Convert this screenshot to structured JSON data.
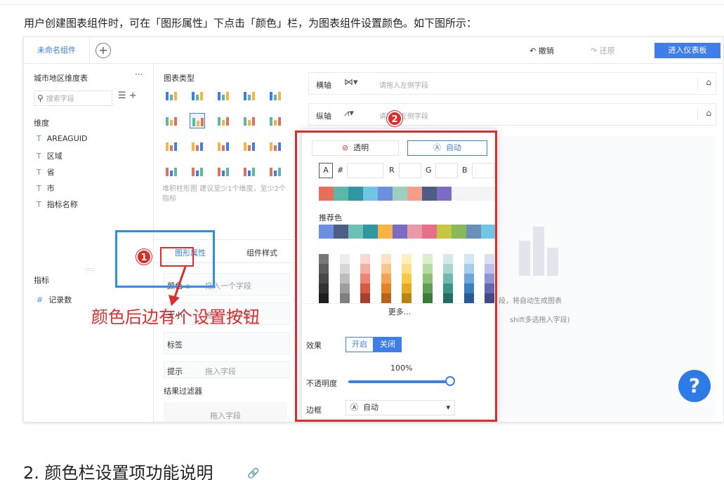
{
  "intro_text": "用户创建图表组件时，可在「图形属性」下点击「颜色」栏，为图表组件设置颜色。如下图所示：",
  "topbar": {
    "tab_label": "未命名组件",
    "add_symbol": "+",
    "undo_label": "撤销",
    "redo_label": "还原",
    "enter_label": "进入仪表板"
  },
  "datapanel": {
    "title": "城市地区维度表",
    "more": "···",
    "search_placeholder": "搜索字段",
    "dimension_title": "维度",
    "dimensions": [
      "AREAGUID",
      "区域",
      "省",
      "市",
      "指标名称"
    ],
    "dimension_type_icon": "T",
    "metric_title": "指标",
    "metrics": [
      "记录数"
    ],
    "metric_type_icon": "#"
  },
  "typepanel": {
    "title": "图表类型",
    "description": "堆积柱形图 建议至少1个维度，至少2个指标",
    "tab_graphic": "图形属性",
    "tab_style": "组件样式",
    "color_label": "颜色",
    "drop_hint": "拖入一个字段",
    "size_label": "大小",
    "label_label": "标签",
    "tip_label": "提示",
    "drop_field": "拖入字段",
    "filter_title": "结果过滤器",
    "filter_drop": "拖入字段"
  },
  "axes": {
    "x_label": "横轴",
    "y_label": "纵轴",
    "placeholder": "请拖入左侧字段"
  },
  "canvas": {
    "hint1": "段，将自动生成图表",
    "hint2": "shift多选拖入字段)",
    "help": "?"
  },
  "popover": {
    "transparent_label": "透明",
    "auto_label": "自动",
    "hash": "#",
    "r": "R",
    "g": "G",
    "b": "B",
    "a_icon": "A",
    "custom_colors": [
      "#e4705c",
      "#5bb8a8",
      "#2f97a2",
      "#6ec5e4",
      "#6d8fe0",
      "#9ccfc0",
      "#f39e8a",
      "#4c5e83",
      "#7d6cc6",
      "#f3f4f6",
      "#f3f4f6",
      "#f3f4f6"
    ],
    "recommend_title": "推荐色",
    "recommend_colors": [
      "#6d8fe0",
      "#4c5e83",
      "#6ec0b5",
      "#2f97a2",
      "#f6b444",
      "#7d6cc6",
      "#e99aa8",
      "#e4708a",
      "#c5c742",
      "#8ab85f",
      "#6b8fb8",
      "#6ec5e4"
    ],
    "grid_columns": [
      [
        "#777777",
        "#5e5e5e",
        "#474747",
        "#333333",
        "#1e1e1e"
      ],
      [
        "#eeeeee",
        "#d8d8d8",
        "#bdbdbd",
        "#9e9e9e",
        "#808080"
      ],
      [
        "#f9d8d0",
        "#f2b0a2",
        "#e98572",
        "#d55a45",
        "#a9402f"
      ],
      [
        "#fde3c6",
        "#f9c68e",
        "#f2a456",
        "#e4832c",
        "#b8641c"
      ],
      [
        "#fdefc0",
        "#fbde86",
        "#f6c84a",
        "#e4a925",
        "#b88414"
      ],
      [
        "#dcedcd",
        "#b9d9a4",
        "#8cbf78",
        "#5f9e55",
        "#3f7a3a"
      ],
      [
        "#d2ebe6",
        "#a6d6cc",
        "#6fb9ad",
        "#3b9488",
        "#246d63"
      ],
      [
        "#d3e7f5",
        "#a7cdeb",
        "#6ca8da",
        "#3a7fbf",
        "#245c93"
      ],
      [
        "#dde0f3",
        "#bbc0e6",
        "#8f95cf",
        "#6269b0",
        "#444a87"
      ]
    ],
    "more_label": "更多...",
    "effect_label": "效果",
    "effect_on": "开启",
    "effect_off": "关闭",
    "opacity_value": "100%",
    "opacity_label": "不透明度",
    "border_label": "边框",
    "border_value": "自动"
  },
  "annotations": {
    "badge1": "1",
    "badge2": "2",
    "note": "颜色后边有个设置按钮"
  },
  "heading2": "2. 颜色栏设置项功能说明",
  "colors": {
    "accent": "#3f7de8",
    "annotation_red": "#e02b2b",
    "annotation_blue": "#2b8ff0"
  }
}
